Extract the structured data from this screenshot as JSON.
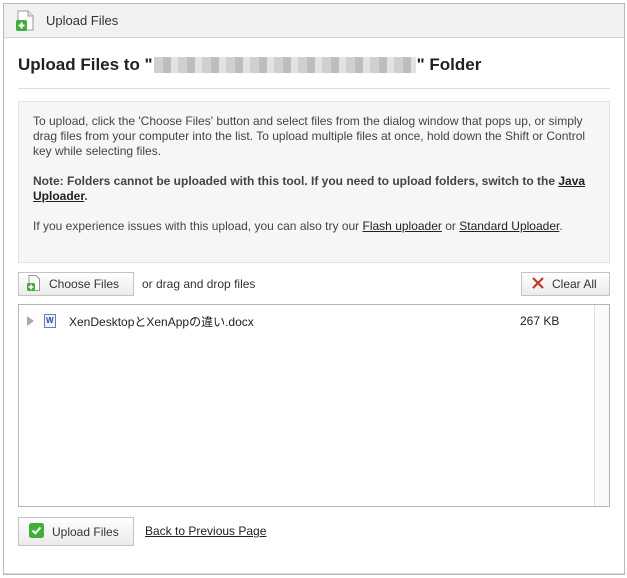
{
  "window": {
    "title": "Upload Files"
  },
  "heading": {
    "prefix": "Upload Files to \"",
    "suffix": "\" Folder"
  },
  "info": {
    "para1": "To upload, click the 'Choose Files' button and select files from the dialog window that pops up, or simply drag files from your computer into the list. To upload multiple files at once, hold down the Shift or Control key while selecting files.",
    "note_text": "Note: Folders cannot be uploaded with this tool. If you need to upload folders, switch to the ",
    "java_link": "Java Uploader",
    "para3_text": "If you experience issues with this upload, you can also try our ",
    "flash_link": "Flash uploader",
    "or_text": " or ",
    "standard_link": "Standard Uploader"
  },
  "toolbar": {
    "choose_label": "Choose Files",
    "dnd_label": "or drag and drop files",
    "clear_label": "Clear All"
  },
  "files": [
    {
      "name": "XenDesktopとXenAppの違い.docx",
      "size": "267 KB"
    }
  ],
  "footer": {
    "upload_label": "Upload Files",
    "back_label": "Back to Previous Page"
  },
  "colors": {
    "green_accent": "#3fae3a",
    "red_x": "#c0392b"
  }
}
